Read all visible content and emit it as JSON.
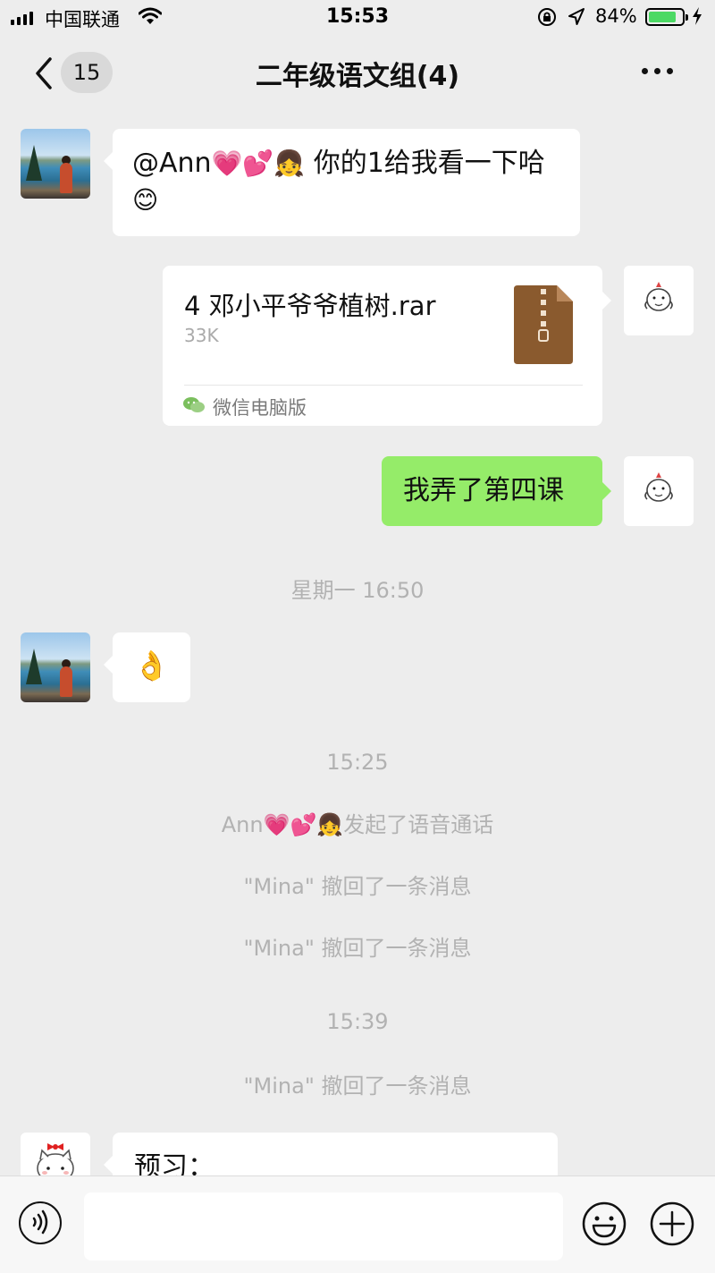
{
  "status_bar": {
    "carrier": "中国联通",
    "time": "15:53",
    "battery_percent": "84%",
    "battery_level": 0.84
  },
  "nav": {
    "back_badge": "15",
    "title": "二年级语文组(4)"
  },
  "messages": {
    "m1": {
      "mention": "@Ann",
      "emoji_after_name": "💗💕👧",
      "text": " 你的1给我看一下哈",
      "emoji_end": "😊"
    },
    "file": {
      "name": "4 邓小平爷爷植树.rar",
      "size": "33K",
      "source": "微信电脑版"
    },
    "m3": {
      "text": "我弄了第四课"
    },
    "ts1": "星期一 16:50",
    "m4": {
      "emoji": "👌"
    },
    "ts2": "15:25",
    "call": {
      "name": "Ann",
      "emoji": "💗💕👧",
      "text": "发起了语音通话"
    },
    "recall1": "\"Mina\" 撤回了一条消息",
    "recall2": "\"Mina\" 撤回了一条消息",
    "ts3": "15:39",
    "recall3": "\"Mina\" 撤回了一条消息",
    "m5": {
      "text": "预习："
    }
  },
  "icons": {
    "signal": "signal-bars-icon",
    "wifi": "wifi-icon",
    "rotation_lock": "rotation-lock-icon",
    "location": "location-arrow-icon",
    "battery": "battery-icon",
    "back": "chevron-left-icon",
    "more": "ellipsis-icon",
    "file": "zip-file-icon",
    "wechat": "wechat-icon",
    "voice": "voice-input-icon",
    "emoji": "emoji-icon",
    "plus": "plus-icon"
  },
  "colors": {
    "background": "#ededed",
    "sent_bubble": "#95ec69",
    "received_bubble": "#ffffff",
    "timestamp_text": "#b2b2b2",
    "file_icon": "#8a5a2e",
    "battery_fill": "#4cd964"
  }
}
